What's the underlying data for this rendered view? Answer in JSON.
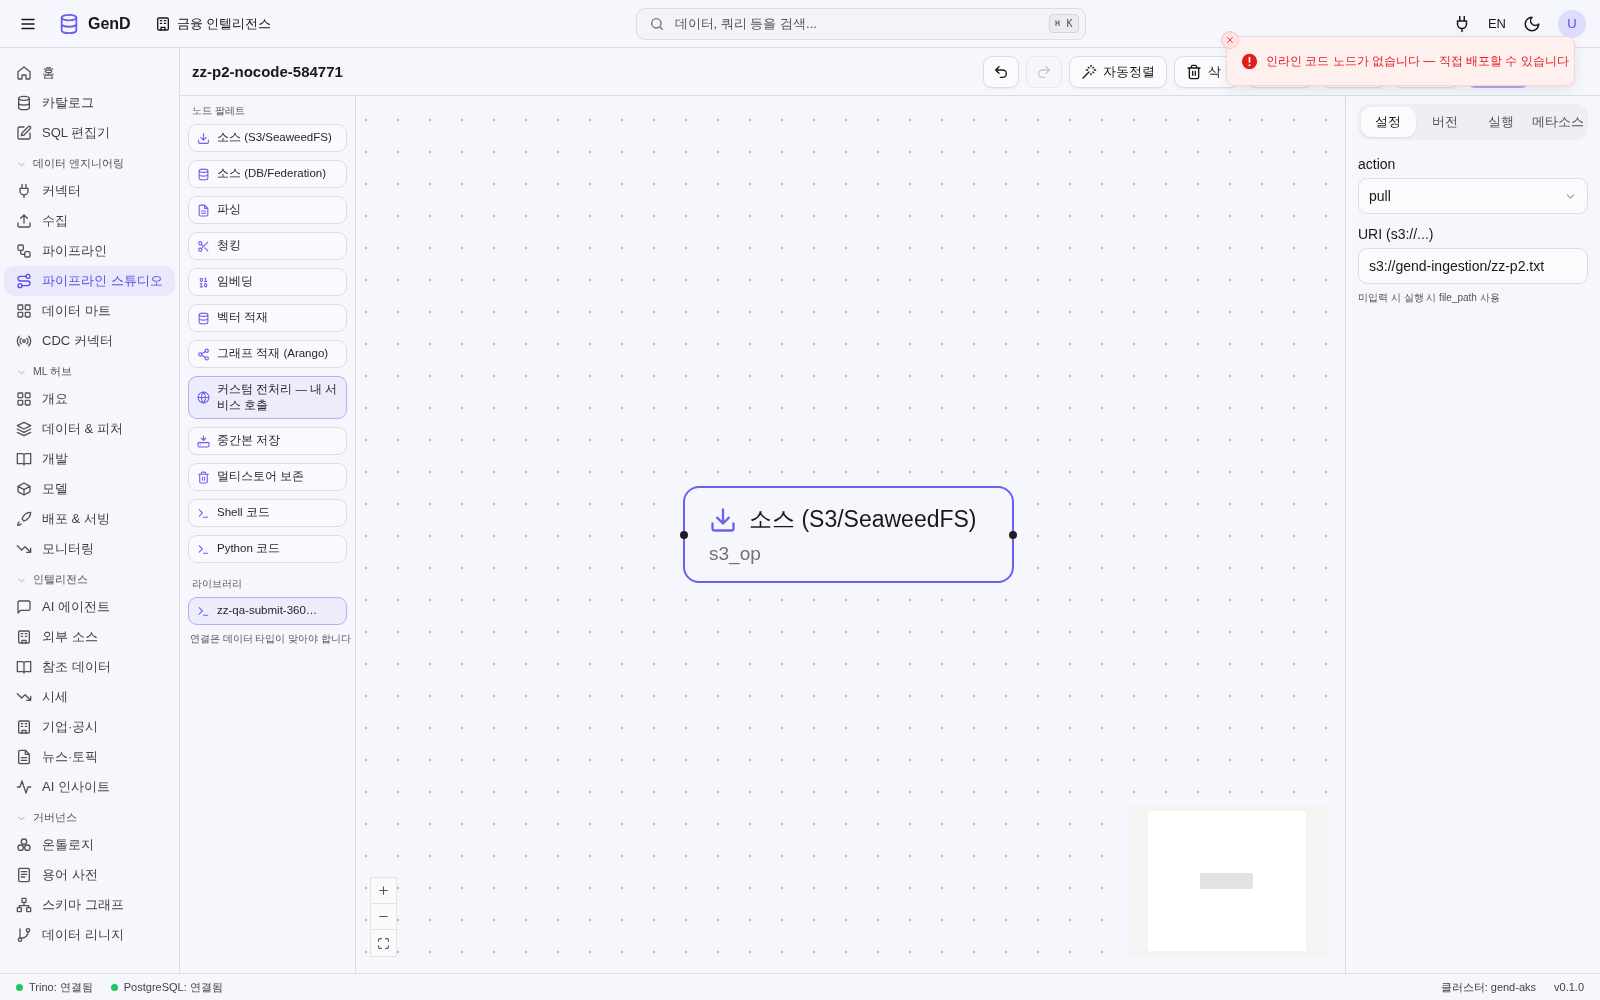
{
  "topbar": {
    "logo_text": "GenD",
    "workspace": "금융 인텔리전스",
    "search": {
      "placeholder": "데이터, 쿼리 등을 검색...",
      "shortcut": "⌘ K"
    },
    "language": "EN",
    "avatar": "U"
  },
  "sidebar": {
    "top_items": [
      {
        "label": "홈",
        "selected": false
      },
      {
        "label": "카탈로그",
        "selected": false
      },
      {
        "label": "SQL 편집기",
        "selected": false
      }
    ],
    "sections": [
      {
        "title": "데이터 엔지니어링",
        "expanded": true,
        "items": [
          {
            "label": "커넥터",
            "selected": false
          },
          {
            "label": "수집",
            "selected": false
          },
          {
            "label": "파이프라인",
            "selected": false
          },
          {
            "label": "파이프라인 스튜디오",
            "selected": true
          },
          {
            "label": "데이터 마트",
            "selected": false
          },
          {
            "label": "CDC 커넥터",
            "selected": false
          }
        ]
      },
      {
        "title": "ML 허브",
        "expanded": true,
        "items": [
          {
            "label": "개요",
            "selected": false
          },
          {
            "label": "데이터 & 피처",
            "selected": false
          },
          {
            "label": "개발",
            "selected": false
          },
          {
            "label": "모델",
            "selected": false
          },
          {
            "label": "배포 & 서빙",
            "selected": false
          },
          {
            "label": "모니터링",
            "selected": false
          }
        ]
      },
      {
        "title": "인텔리전스",
        "expanded": true,
        "items": [
          {
            "label": "AI 에이전트",
            "selected": false
          },
          {
            "label": "외부 소스",
            "selected": false
          },
          {
            "label": "참조 데이터",
            "selected": false
          },
          {
            "label": "시세",
            "selected": false
          },
          {
            "label": "기업·공시",
            "selected": false
          },
          {
            "label": "뉴스·토픽",
            "selected": false
          },
          {
            "label": "AI 인사이트",
            "selected": false
          }
        ]
      },
      {
        "title": "거버넌스",
        "expanded": true,
        "items": [
          {
            "label": "온톨로지",
            "selected": false
          },
          {
            "label": "용어 사전",
            "selected": false
          },
          {
            "label": "스키마 그래프",
            "selected": false
          },
          {
            "label": "데이터 리니지",
            "selected": false
          }
        ]
      }
    ]
  },
  "page": {
    "title": "zz-p2-nocode-584771",
    "toolbar": [
      {
        "kind": "undo",
        "disabled": false
      },
      {
        "kind": "redo",
        "disabled": true
      },
      {
        "kind": "autolayout",
        "label": "자동정렬",
        "disabled": false
      },
      {
        "kind": "delete",
        "label": "삭",
        "disabled": false
      },
      {
        "kind": "covered"
      },
      {
        "kind": "covered"
      },
      {
        "kind": "covered"
      },
      {
        "kind": "primary",
        "disabled": true
      }
    ]
  },
  "toast": {
    "message": "인라인 코드 노드가 없습니다 — 직접 배포할 수 있습니다"
  },
  "palette": {
    "title": "노드 팔레트",
    "items": [
      {
        "label": "소스 (S3/SeaweedFS)",
        "kind": "builtin"
      },
      {
        "label": "소스 (DB/Federation)",
        "kind": "builtin"
      },
      {
        "label": "파싱",
        "kind": "builtin"
      },
      {
        "label": "청킹",
        "kind": "builtin"
      },
      {
        "label": "임베딩",
        "kind": "builtin"
      },
      {
        "label": "벡터 적재",
        "kind": "builtin"
      },
      {
        "label": "그래프 적재 (Arango)",
        "kind": "builtin"
      },
      {
        "label": "커스텀 전처리 — 내 서비스 호출",
        "kind": "custom"
      },
      {
        "label": "중간본 저장",
        "kind": "builtin"
      },
      {
        "label": "멀티스토어 보존",
        "kind": "builtin"
      },
      {
        "label": "Shell 코드",
        "kind": "builtin"
      },
      {
        "label": "Python 코드",
        "kind": "builtin"
      }
    ],
    "library_title": "라이브러리",
    "library_items": [
      {
        "label": "zz-qa-submit-360…",
        "kind": "custom"
      }
    ],
    "hint": "연결은 데이터 타입이 맞아야 합니다"
  },
  "canvas": {
    "nodes": [
      {
        "title": "소스 (S3/SeaweedFS)",
        "subtitle": "s3_op",
        "selected": true
      }
    ]
  },
  "inspector": {
    "tabs": [
      {
        "label": "설정",
        "selected": true
      },
      {
        "label": "버전",
        "selected": false
      },
      {
        "label": "실행",
        "selected": false
      },
      {
        "label": "메타소스",
        "selected": false
      }
    ],
    "fields": [
      {
        "kind": "select",
        "label": "action",
        "value": "pull"
      },
      {
        "kind": "text",
        "label": "URI (s3://...)",
        "value": "s3://gend-ingestion/zz-p2.txt",
        "hint": "미입력 시 실행 시 file_path 사용"
      }
    ]
  },
  "status_bar": {
    "connections": [
      {
        "label": "Trino: 연결됨",
        "color": "#22c55e"
      },
      {
        "label": "PostgreSQL: 연결됨",
        "color": "#22c55e"
      }
    ],
    "cluster": "클러스터: gend-aks",
    "version": "v0.1.0"
  }
}
